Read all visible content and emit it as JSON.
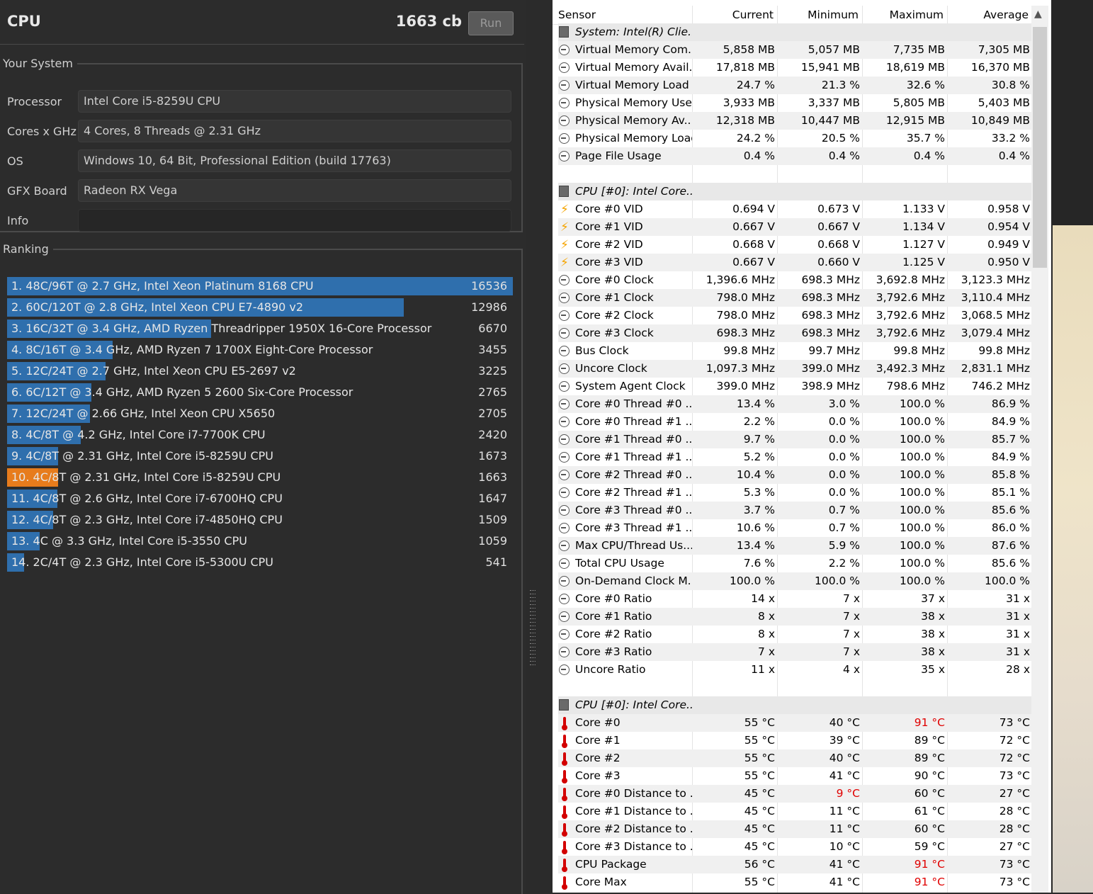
{
  "cinebench": {
    "title": "CPU",
    "score": "1663 cb",
    "run_label": "Run",
    "your_system": {
      "legend": "Your System",
      "rows": [
        {
          "label": "Processor",
          "value": "Intel Core i5-8259U CPU"
        },
        {
          "label": "Cores x GHz",
          "value": "4 Cores, 8 Threads @ 2.31 GHz"
        },
        {
          "label": "OS",
          "value": "Windows 10, 64 Bit, Professional Edition (build 17763)"
        },
        {
          "label": "GFX Board",
          "value": "Radeon RX Vega"
        },
        {
          "label": "Info",
          "value": ""
        }
      ]
    },
    "ranking": {
      "legend": "Ranking",
      "items": [
        {
          "text": "1. 48C/96T @ 2.7 GHz, Intel Xeon Platinum 8168 CPU",
          "score": "16536",
          "fraction": 1.0,
          "current": false
        },
        {
          "text": "2. 60C/120T @ 2.8 GHz, Intel Xeon CPU E7-4890 v2",
          "score": "12986",
          "fraction": 0.785,
          "current": false
        },
        {
          "text": "3. 16C/32T @ 3.4 GHz, AMD Ryzen Threadripper 1950X 16-Core Processor",
          "score": "6670",
          "fraction": 0.403,
          "current": false
        },
        {
          "text": "4. 8C/16T @ 3.4 GHz, AMD Ryzen 7 1700X Eight-Core Processor",
          "score": "3455",
          "fraction": 0.209,
          "current": false
        },
        {
          "text": "5. 12C/24T @ 2.7 GHz, Intel Xeon CPU E5-2697 v2",
          "score": "3225",
          "fraction": 0.195,
          "current": false
        },
        {
          "text": "6. 6C/12T @ 3.4 GHz, AMD Ryzen 5 2600 Six-Core Processor",
          "score": "2765",
          "fraction": 0.167,
          "current": false
        },
        {
          "text": "7. 12C/24T @ 2.66 GHz, Intel Xeon CPU X5650",
          "score": "2705",
          "fraction": 0.164,
          "current": false
        },
        {
          "text": "8. 4C/8T @ 4.2 GHz, Intel Core i7-7700K CPU",
          "score": "2420",
          "fraction": 0.146,
          "current": false
        },
        {
          "text": "9. 4C/8T @ 2.31 GHz, Intel Core i5-8259U CPU",
          "score": "1673",
          "fraction": 0.101,
          "current": false
        },
        {
          "text": "10. 4C/8T @ 2.31 GHz, Intel Core i5-8259U CPU",
          "score": "1663",
          "fraction": 0.101,
          "current": true
        },
        {
          "text": "11. 4C/8T @ 2.6 GHz, Intel Core i7-6700HQ CPU",
          "score": "1647",
          "fraction": 0.1,
          "current": false
        },
        {
          "text": "12. 4C/8T @ 2.3 GHz, Intel Core i7-4850HQ CPU",
          "score": "1509",
          "fraction": 0.091,
          "current": false
        },
        {
          "text": "13. 4C @ 3.3 GHz, Intel Core i5-3550 CPU",
          "score": "1059",
          "fraction": 0.064,
          "current": false
        },
        {
          "text": "14. 2C/4T @ 2.3 GHz, Intel Core i5-5300U CPU",
          "score": "541",
          "fraction": 0.033,
          "current": false
        }
      ]
    }
  },
  "hwinfo": {
    "headers": [
      "Sensor",
      "Current",
      "Minimum",
      "Maximum",
      "Average"
    ],
    "rows": [
      {
        "type": "group",
        "icon": "chip",
        "name": "System: Intel(R) Clie..."
      },
      {
        "icon": "clock",
        "name": "Virtual Memory Com...",
        "v": [
          "5,858 MB",
          "5,057 MB",
          "7,735 MB",
          "7,305 MB"
        ]
      },
      {
        "icon": "clock",
        "name": "Virtual Memory Avail...",
        "v": [
          "17,818 MB",
          "15,941 MB",
          "18,619 MB",
          "16,370 MB"
        ]
      },
      {
        "icon": "clock",
        "name": "Virtual Memory Load",
        "v": [
          "24.7 %",
          "21.3 %",
          "32.6 %",
          "30.8 %"
        ]
      },
      {
        "icon": "clock",
        "name": "Physical Memory Used",
        "v": [
          "3,933 MB",
          "3,337 MB",
          "5,805 MB",
          "5,403 MB"
        ]
      },
      {
        "icon": "clock",
        "name": "Physical Memory Av...",
        "v": [
          "12,318 MB",
          "10,447 MB",
          "12,915 MB",
          "10,849 MB"
        ]
      },
      {
        "icon": "clock",
        "name": "Physical Memory Load",
        "v": [
          "24.2 %",
          "20.5 %",
          "35.7 %",
          "33.2 %"
        ]
      },
      {
        "icon": "clock",
        "name": "Page File Usage",
        "v": [
          "0.4 %",
          "0.4 %",
          "0.4 %",
          "0.4 %"
        ]
      },
      {
        "type": "blank"
      },
      {
        "type": "group",
        "icon": "chip",
        "name": "CPU [#0]: Intel Core..."
      },
      {
        "icon": "volt",
        "name": "Core #0 VID",
        "v": [
          "0.694 V",
          "0.673 V",
          "1.133 V",
          "0.958 V"
        ]
      },
      {
        "icon": "volt",
        "name": "Core #1 VID",
        "v": [
          "0.667 V",
          "0.667 V",
          "1.134 V",
          "0.954 V"
        ]
      },
      {
        "icon": "volt",
        "name": "Core #2 VID",
        "v": [
          "0.668 V",
          "0.668 V",
          "1.127 V",
          "0.949 V"
        ]
      },
      {
        "icon": "volt",
        "name": "Core #3 VID",
        "v": [
          "0.667 V",
          "0.660 V",
          "1.125 V",
          "0.950 V"
        ]
      },
      {
        "icon": "clock",
        "name": "Core #0 Clock",
        "v": [
          "1,396.6 MHz",
          "698.3 MHz",
          "3,692.8 MHz",
          "3,123.3 MHz"
        ]
      },
      {
        "icon": "clock",
        "name": "Core #1 Clock",
        "v": [
          "798.0 MHz",
          "698.3 MHz",
          "3,792.6 MHz",
          "3,110.4 MHz"
        ]
      },
      {
        "icon": "clock",
        "name": "Core #2 Clock",
        "v": [
          "798.0 MHz",
          "698.3 MHz",
          "3,792.6 MHz",
          "3,068.5 MHz"
        ]
      },
      {
        "icon": "clock",
        "name": "Core #3 Clock",
        "v": [
          "698.3 MHz",
          "698.3 MHz",
          "3,792.6 MHz",
          "3,079.4 MHz"
        ]
      },
      {
        "icon": "clock",
        "name": "Bus Clock",
        "v": [
          "99.8 MHz",
          "99.7 MHz",
          "99.8 MHz",
          "99.8 MHz"
        ]
      },
      {
        "icon": "clock",
        "name": "Uncore Clock",
        "v": [
          "1,097.3 MHz",
          "399.0 MHz",
          "3,492.3 MHz",
          "2,831.1 MHz"
        ]
      },
      {
        "icon": "clock",
        "name": "System Agent Clock",
        "v": [
          "399.0 MHz",
          "398.9 MHz",
          "798.6 MHz",
          "746.2 MHz"
        ]
      },
      {
        "icon": "clock",
        "name": "Core #0 Thread #0 ...",
        "v": [
          "13.4 %",
          "3.0 %",
          "100.0 %",
          "86.9 %"
        ]
      },
      {
        "icon": "clock",
        "name": "Core #0 Thread #1 ...",
        "v": [
          "2.2 %",
          "0.0 %",
          "100.0 %",
          "84.9 %"
        ]
      },
      {
        "icon": "clock",
        "name": "Core #1 Thread #0 ...",
        "v": [
          "9.7 %",
          "0.0 %",
          "100.0 %",
          "85.7 %"
        ]
      },
      {
        "icon": "clock",
        "name": "Core #1 Thread #1 ...",
        "v": [
          "5.2 %",
          "0.0 %",
          "100.0 %",
          "84.9 %"
        ]
      },
      {
        "icon": "clock",
        "name": "Core #2 Thread #0 ...",
        "v": [
          "10.4 %",
          "0.0 %",
          "100.0 %",
          "85.8 %"
        ]
      },
      {
        "icon": "clock",
        "name": "Core #2 Thread #1 ...",
        "v": [
          "5.3 %",
          "0.0 %",
          "100.0 %",
          "85.1 %"
        ]
      },
      {
        "icon": "clock",
        "name": "Core #3 Thread #0 ...",
        "v": [
          "3.7 %",
          "0.7 %",
          "100.0 %",
          "85.6 %"
        ]
      },
      {
        "icon": "clock",
        "name": "Core #3 Thread #1 ...",
        "v": [
          "10.6 %",
          "0.7 %",
          "100.0 %",
          "86.0 %"
        ]
      },
      {
        "icon": "clock",
        "name": "Max CPU/Thread Us...",
        "v": [
          "13.4 %",
          "5.9 %",
          "100.0 %",
          "87.6 %"
        ]
      },
      {
        "icon": "clock",
        "name": "Total CPU Usage",
        "v": [
          "7.6 %",
          "2.2 %",
          "100.0 %",
          "85.6 %"
        ]
      },
      {
        "icon": "clock",
        "name": "On-Demand Clock M...",
        "v": [
          "100.0 %",
          "100.0 %",
          "100.0 %",
          "100.0 %"
        ]
      },
      {
        "icon": "clock",
        "name": "Core #0 Ratio",
        "v": [
          "14 x",
          "7 x",
          "37 x",
          "31 x"
        ]
      },
      {
        "icon": "clock",
        "name": "Core #1 Ratio",
        "v": [
          "8 x",
          "7 x",
          "38 x",
          "31 x"
        ]
      },
      {
        "icon": "clock",
        "name": "Core #2 Ratio",
        "v": [
          "8 x",
          "7 x",
          "38 x",
          "31 x"
        ]
      },
      {
        "icon": "clock",
        "name": "Core #3 Ratio",
        "v": [
          "7 x",
          "7 x",
          "38 x",
          "31 x"
        ]
      },
      {
        "icon": "clock",
        "name": "Uncore Ratio",
        "v": [
          "11 x",
          "4 x",
          "35 x",
          "28 x"
        ]
      },
      {
        "type": "blank"
      },
      {
        "type": "group",
        "icon": "chip",
        "name": "CPU [#0]: Intel Core..."
      },
      {
        "icon": "therm",
        "name": "Core #0",
        "v": [
          "55 °C",
          "40 °C",
          "91 °C",
          "73 °C"
        ],
        "red": [
          false,
          false,
          true,
          false
        ]
      },
      {
        "icon": "therm",
        "name": "Core #1",
        "v": [
          "55 °C",
          "39 °C",
          "89 °C",
          "72 °C"
        ]
      },
      {
        "icon": "therm",
        "name": "Core #2",
        "v": [
          "55 °C",
          "40 °C",
          "89 °C",
          "72 °C"
        ]
      },
      {
        "icon": "therm",
        "name": "Core #3",
        "v": [
          "55 °C",
          "41 °C",
          "90 °C",
          "73 °C"
        ]
      },
      {
        "icon": "therm",
        "name": "Core #0 Distance to ...",
        "v": [
          "45 °C",
          "9 °C",
          "60 °C",
          "27 °C"
        ],
        "red": [
          false,
          true,
          false,
          false
        ]
      },
      {
        "icon": "therm",
        "name": "Core #1 Distance to ...",
        "v": [
          "45 °C",
          "11 °C",
          "61 °C",
          "28 °C"
        ]
      },
      {
        "icon": "therm",
        "name": "Core #2 Distance to ...",
        "v": [
          "45 °C",
          "11 °C",
          "60 °C",
          "28 °C"
        ]
      },
      {
        "icon": "therm",
        "name": "Core #3 Distance to ...",
        "v": [
          "45 °C",
          "10 °C",
          "59 °C",
          "27 °C"
        ]
      },
      {
        "icon": "therm",
        "name": "CPU Package",
        "v": [
          "56 °C",
          "41 °C",
          "91 °C",
          "73 °C"
        ],
        "red": [
          false,
          false,
          true,
          false
        ]
      },
      {
        "icon": "therm",
        "name": "Core Max",
        "v": [
          "55 °C",
          "41 °C",
          "91 °C",
          "73 °C"
        ],
        "red": [
          false,
          false,
          true,
          false
        ]
      }
    ]
  }
}
